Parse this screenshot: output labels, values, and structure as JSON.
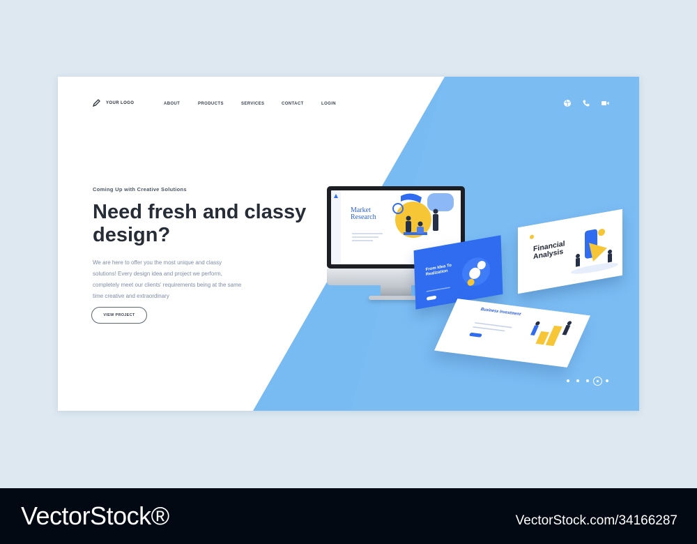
{
  "brand": {
    "logo_text": "YOUR LOGO"
  },
  "nav": {
    "items": [
      "ABOUT",
      "PRODUCTS",
      "SERVICES",
      "CONTACT",
      "LOGIN"
    ]
  },
  "header_icons": [
    "dribbble-icon",
    "phone-icon",
    "video-icon"
  ],
  "hero": {
    "tagline": "Coming Up with Creative Solutions",
    "headline": "Need fresh and classy design?",
    "body": "We are here to offer you the most unique and classy solutions! Every design idea and project we perform, completely meet our clients' requirements being at the same time creative and extraordinary",
    "button_label": "VIEW PROJECT"
  },
  "showcase": {
    "monitor_title": "Market Research",
    "card_idea_title": "From Idea To Realization",
    "card_financial_title": "Financial Analysis",
    "card_business_title": "Business Investment"
  },
  "slider": {
    "dot_count": 5,
    "active_index": 3
  },
  "colors": {
    "accent_blue": "#78bbf3",
    "card_blue": "#2f6cf0",
    "text_dark": "#262d37",
    "text_muted": "#7c8da4",
    "footer_bg": "#030913"
  },
  "watermark": {
    "logo": "VectorStock®",
    "id": "VectorStock.com/34166287"
  }
}
